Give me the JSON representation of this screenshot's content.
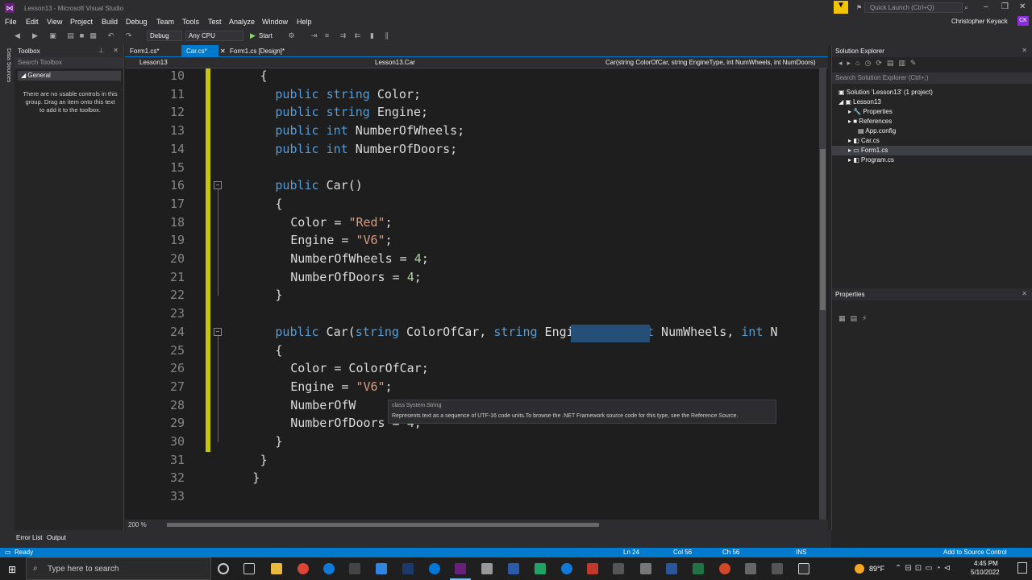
{
  "window": {
    "title": "Lesson13 - Microsoft Visual Studio",
    "quick_launch_placeholder": "Quick Launch (Ctrl+Q)",
    "user": "Christopher Keyack",
    "user_initials": "CK"
  },
  "menu": [
    "File",
    "Edit",
    "View",
    "Project",
    "Build",
    "Debug",
    "Team",
    "Tools",
    "Test",
    "Analyze",
    "Window",
    "Help"
  ],
  "toolbar": {
    "config": "Debug",
    "platform": "Any CPU",
    "start_label": "Start"
  },
  "toolbox": {
    "title": "Toolbox",
    "search_placeholder": "Search Toolbox",
    "group": "General",
    "empty_message": "There are no usable controls in this group. Drag an item onto this text to add it to the toolbox.",
    "side_tab": "Data Sources"
  },
  "tabs": [
    {
      "label": "Form1.cs*"
    },
    {
      "label": "Car.cs*"
    },
    {
      "label": "Form1.cs [Design]*"
    }
  ],
  "navbar": {
    "project": "Lesson13",
    "class": "Lesson13.Car",
    "member": "Car(string ColorOfCar, string EngineType, int NumWheels, int NumDoors)"
  },
  "code_lines": [
    {
      "n": "10",
      "t": "{"
    },
    {
      "n": "11",
      "t": "public string Color;"
    },
    {
      "n": "12",
      "t": "public string Engine;"
    },
    {
      "n": "13",
      "t": "public int NumberOfWheels;"
    },
    {
      "n": "14",
      "t": "public int NumberOfDoors;"
    },
    {
      "n": "15",
      "t": ""
    },
    {
      "n": "16",
      "t": "public Car()"
    },
    {
      "n": "17",
      "t": "{"
    },
    {
      "n": "18",
      "t": "Color = \"Red\";"
    },
    {
      "n": "19",
      "t": "Engine = \"V6\";"
    },
    {
      "n": "20",
      "t": "NumberOfWheels = 4;"
    },
    {
      "n": "21",
      "t": "NumberOfDoors = 4;"
    },
    {
      "n": "22",
      "t": "}"
    },
    {
      "n": "23",
      "t": ""
    },
    {
      "n": "24",
      "t": "public Car(string ColorOfCar, string EngineType, int NumWheels, int N"
    },
    {
      "n": "25",
      "t": "{"
    },
    {
      "n": "26",
      "t": "Color = ColorOfCar;"
    },
    {
      "n": "27",
      "t": "Engine = \"V6\";"
    },
    {
      "n": "28",
      "t": "NumberOfW"
    },
    {
      "n": "29",
      "t": "NumberOfDoors = 4;"
    },
    {
      "n": "30",
      "t": "}"
    },
    {
      "n": "31",
      "t": "}"
    },
    {
      "n": "32",
      "t": "}"
    },
    {
      "n": "33",
      "t": ""
    }
  ],
  "tooltip": {
    "title": "class System.String",
    "body": "Represents text as a sequence of UTF-16 code units.To browse the .NET Framework source code for this type, see the Reference Source."
  },
  "zoom": "200 %",
  "solution_explorer": {
    "title": "Solution Explorer",
    "search_placeholder": "Search Solution Explorer (Ctrl+;)",
    "items": [
      "Solution 'Lesson13' (1 project)",
      "Lesson13",
      "Properties",
      "References",
      "App.config",
      "Car.cs",
      "Form1.cs",
      "Program.cs"
    ]
  },
  "properties": {
    "title": "Properties"
  },
  "bottom_tabs": [
    "Error List",
    "Output"
  ],
  "status": {
    "ready": "Ready",
    "ln": "Ln 24",
    "col": "Col 56",
    "ch": "Ch 56",
    "ins": "INS",
    "source_control": "Add to Source Control"
  },
  "taskbar": {
    "search_placeholder": "Type here to search",
    "weather": "89°F",
    "time": "4:45 PM",
    "date": "5/10/2022"
  },
  "colors": {
    "accent": "#007acc",
    "keyword": "#569cd6",
    "string": "#d69d85",
    "number": "#b5cea8"
  }
}
